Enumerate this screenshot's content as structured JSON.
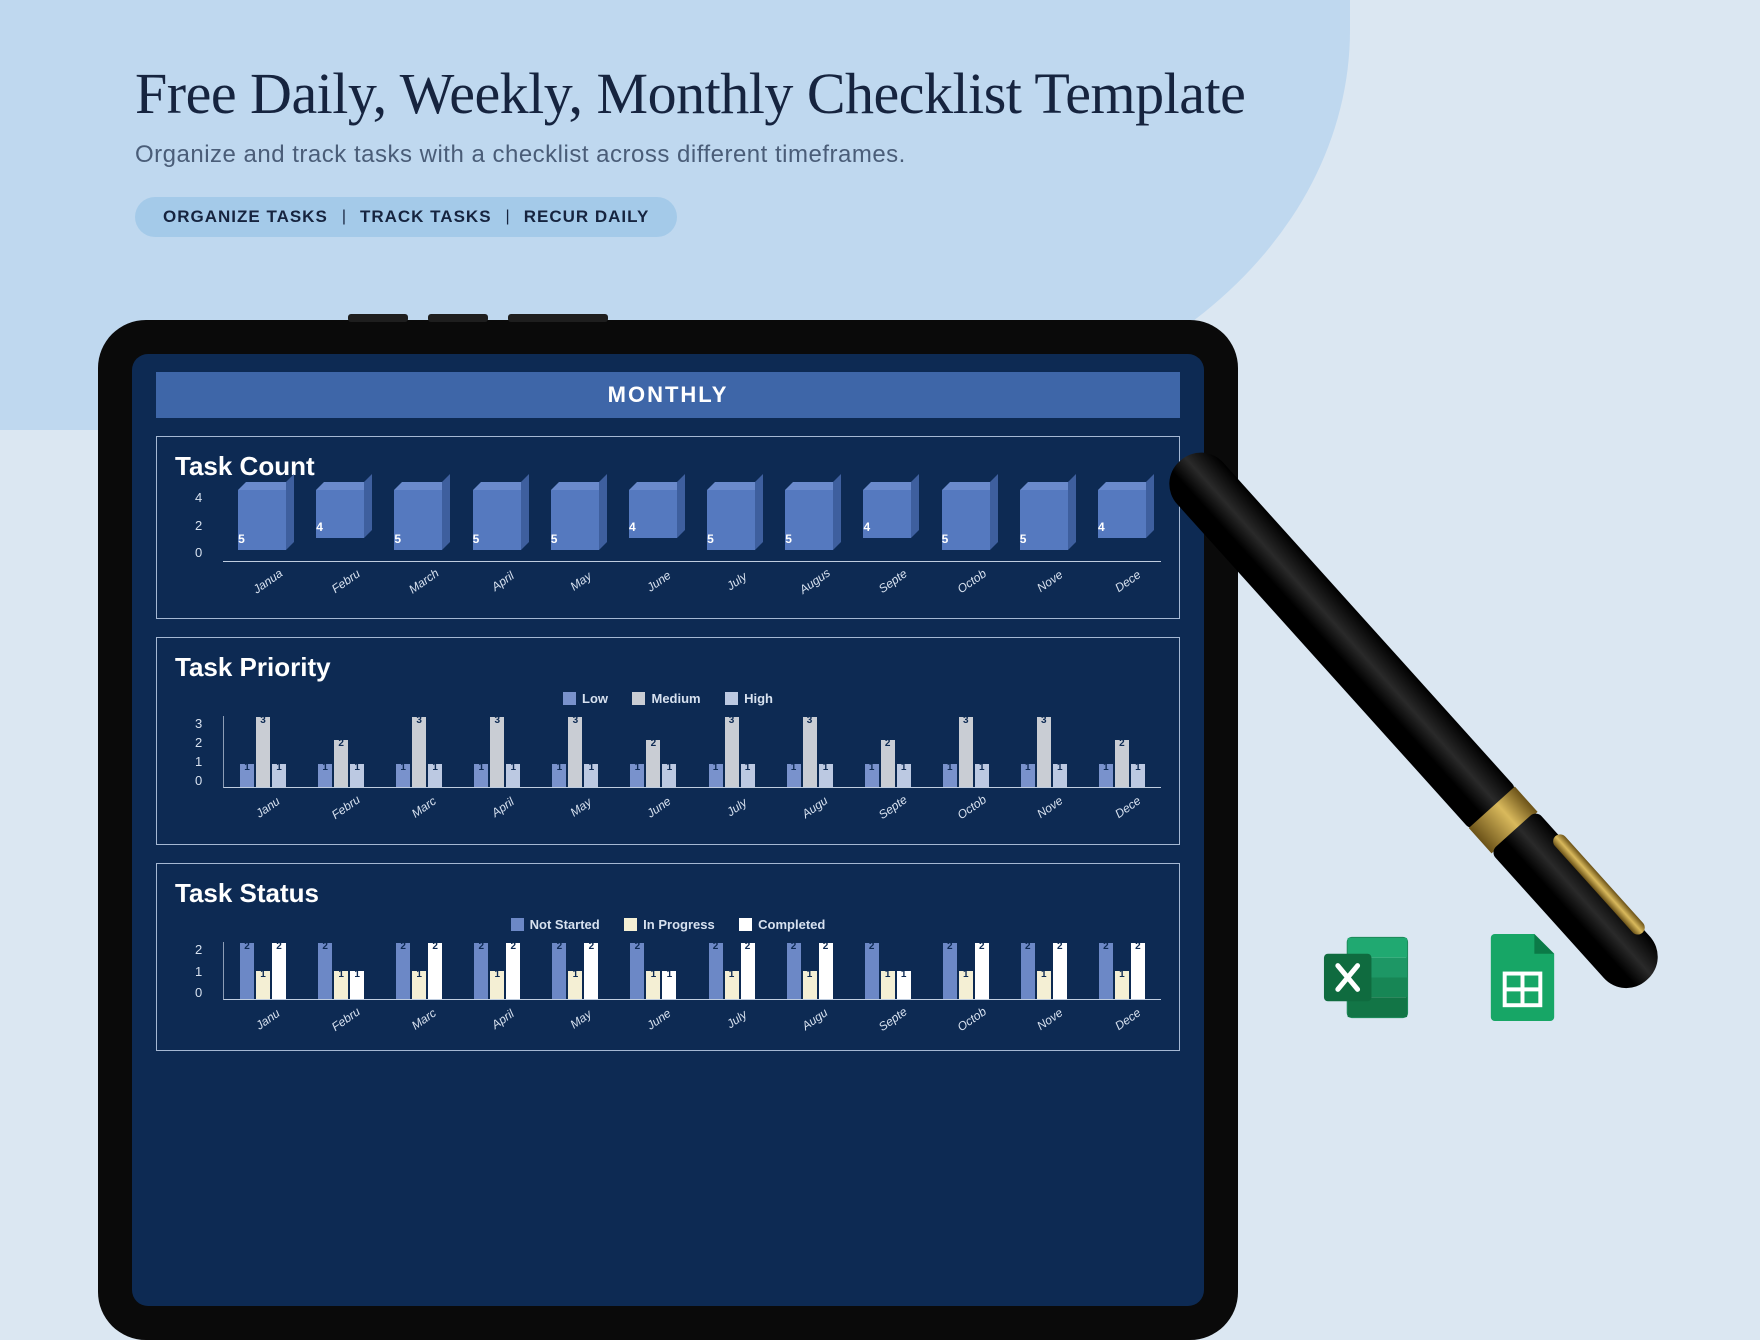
{
  "header": {
    "title": "Free Daily, Weekly, Monthly Checklist Template",
    "subtitle": "Organize and track tasks with a checklist across different timeframes.",
    "pills": [
      "ORGANIZE TASKS",
      "TRACK TASKS",
      "RECUR DAILY"
    ]
  },
  "sheet": {
    "title": "MONTHLY",
    "months": [
      "Janua",
      "Febru",
      "March",
      "April",
      "May",
      "June",
      "July",
      "Augus",
      "Septe",
      "Octob",
      "Nove",
      "Dece"
    ],
    "months2": [
      "Janu",
      "Febru",
      "Marc",
      "April",
      "May",
      "June",
      "July",
      "Augu",
      "Septe",
      "Octob",
      "Nove",
      "Dece"
    ],
    "task_count": {
      "title": "Task Count",
      "y": [
        "4",
        "2",
        "0"
      ],
      "values": [
        5,
        4,
        5,
        5,
        5,
        4,
        5,
        5,
        4,
        5,
        5,
        4
      ]
    },
    "task_priority": {
      "title": "Task Priority",
      "legend": [
        "Low",
        "Medium",
        "High"
      ],
      "y": [
        "3",
        "2",
        "1",
        "0"
      ],
      "series": [
        [
          1,
          3,
          1
        ],
        [
          1,
          2,
          1
        ],
        [
          1,
          3,
          1
        ],
        [
          1,
          3,
          1
        ],
        [
          1,
          3,
          1
        ],
        [
          1,
          2,
          1
        ],
        [
          1,
          3,
          1
        ],
        [
          1,
          3,
          1
        ],
        [
          1,
          2,
          1
        ],
        [
          1,
          3,
          1
        ],
        [
          1,
          3,
          1
        ],
        [
          1,
          2,
          1
        ]
      ]
    },
    "task_status": {
      "title": "Task Status",
      "legend": [
        "Not Started",
        "In Progress",
        "Completed"
      ],
      "y": [
        "2",
        "1",
        "0"
      ],
      "series": [
        [
          2,
          1,
          2
        ],
        [
          2,
          1,
          1
        ],
        [
          2,
          1,
          2
        ],
        [
          2,
          1,
          2
        ],
        [
          2,
          1,
          2
        ],
        [
          2,
          1,
          1
        ],
        [
          2,
          1,
          2
        ],
        [
          2,
          1,
          2
        ],
        [
          2,
          1,
          1
        ],
        [
          2,
          1,
          2
        ],
        [
          2,
          1,
          2
        ],
        [
          2,
          1,
          2
        ]
      ]
    }
  },
  "icons": {
    "excel": "Excel",
    "sheets": "Google Sheets"
  },
  "colors": {
    "low": "#7992cc",
    "medium": "#c9cdd4",
    "high": "#bcc9e2",
    "not_started": "#6c88c6",
    "in_progress": "#f4efd4",
    "completed": "#ffffff"
  },
  "chart_data": [
    {
      "type": "bar",
      "title": "Task Count",
      "categories": [
        "Janua",
        "Febru",
        "March",
        "April",
        "May",
        "June",
        "July",
        "Augus",
        "Septe",
        "Octob",
        "Nove",
        "Dece"
      ],
      "values": [
        5,
        4,
        5,
        5,
        5,
        4,
        5,
        5,
        4,
        5,
        5,
        4
      ],
      "ylim": [
        0,
        4
      ],
      "y_ticks": [
        0,
        2,
        4
      ],
      "xlabel": "",
      "ylabel": ""
    },
    {
      "type": "bar",
      "title": "Task Priority",
      "categories": [
        "Janu",
        "Febru",
        "Marc",
        "April",
        "May",
        "June",
        "July",
        "Augu",
        "Septe",
        "Octob",
        "Nove",
        "Dece"
      ],
      "series": [
        {
          "name": "Low",
          "values": [
            1,
            1,
            1,
            1,
            1,
            1,
            1,
            1,
            1,
            1,
            1,
            1
          ]
        },
        {
          "name": "Medium",
          "values": [
            3,
            2,
            3,
            3,
            3,
            2,
            3,
            3,
            2,
            3,
            3,
            2
          ]
        },
        {
          "name": "High",
          "values": [
            1,
            1,
            1,
            1,
            1,
            1,
            1,
            1,
            1,
            1,
            1,
            1
          ]
        }
      ],
      "ylim": [
        0,
        3
      ],
      "y_ticks": [
        0,
        1,
        2,
        3
      ],
      "xlabel": "",
      "ylabel": ""
    },
    {
      "type": "bar",
      "title": "Task Status",
      "categories": [
        "Janu",
        "Febru",
        "Marc",
        "April",
        "May",
        "June",
        "July",
        "Augu",
        "Septe",
        "Octob",
        "Nove",
        "Dece"
      ],
      "series": [
        {
          "name": "Not Started",
          "values": [
            2,
            2,
            2,
            2,
            2,
            2,
            2,
            2,
            2,
            2,
            2,
            2
          ]
        },
        {
          "name": "In Progress",
          "values": [
            1,
            1,
            1,
            1,
            1,
            1,
            1,
            1,
            1,
            1,
            1,
            1
          ]
        },
        {
          "name": "Completed",
          "values": [
            2,
            1,
            2,
            2,
            2,
            1,
            2,
            2,
            1,
            2,
            2,
            2
          ]
        }
      ],
      "ylim": [
        0,
        2
      ],
      "y_ticks": [
        0,
        1,
        2
      ],
      "xlabel": "",
      "ylabel": ""
    }
  ]
}
